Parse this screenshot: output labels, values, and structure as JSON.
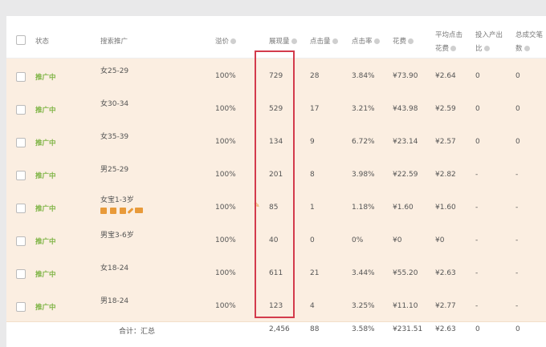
{
  "headers": {
    "status": "状态",
    "keyword": "搜索推广",
    "premium": "溢价",
    "impressions": "展现量",
    "clicks": "点击量",
    "ctr": "点击率",
    "cost": "花费",
    "avg_cpc_line1": "平均点击",
    "avg_cpc_line2": "花费",
    "roi_line1": "投入产出",
    "roi_line2": "比",
    "total_deals_line1": "总成交笔",
    "total_deals_line2": "数"
  },
  "rows": [
    {
      "status": "推广中",
      "name": "女25-29",
      "premium": "100%",
      "impressions": "729",
      "clicks": "28",
      "ctr": "3.84%",
      "cost": "¥73.90",
      "cpc": "¥2.64",
      "roi": "0",
      "deals": "0"
    },
    {
      "status": "推广中",
      "name": "女30-34",
      "premium": "100%",
      "impressions": "529",
      "clicks": "17",
      "ctr": "3.21%",
      "cost": "¥43.98",
      "cpc": "¥2.59",
      "roi": "0",
      "deals": "0"
    },
    {
      "status": "推广中",
      "name": "女35-39",
      "premium": "100%",
      "impressions": "134",
      "clicks": "9",
      "ctr": "6.72%",
      "cost": "¥23.14",
      "cpc": "¥2.57",
      "roi": "0",
      "deals": "0"
    },
    {
      "status": "推广中",
      "name": "男25-29",
      "premium": "100%",
      "impressions": "201",
      "clicks": "8",
      "ctr": "3.98%",
      "cost": "¥22.59",
      "cpc": "¥2.82",
      "roi": "-",
      "deals": "-"
    },
    {
      "status": "推广中",
      "name": "女宝1-3岁",
      "premium": "100%",
      "impressions": "85",
      "clicks": "1",
      "ctr": "1.18%",
      "cost": "¥1.60",
      "cpc": "¥1.60",
      "roi": "-",
      "deals": "-"
    },
    {
      "status": "推广中",
      "name": "男宝3-6岁",
      "premium": "100%",
      "impressions": "40",
      "clicks": "0",
      "ctr": "0%",
      "cost": "¥0",
      "cpc": "¥0",
      "roi": "-",
      "deals": "-"
    },
    {
      "status": "推广中",
      "name": "女18-24",
      "premium": "100%",
      "impressions": "611",
      "clicks": "21",
      "ctr": "3.44%",
      "cost": "¥55.20",
      "cpc": "¥2.63",
      "roi": "-",
      "deals": "-"
    },
    {
      "status": "推广中",
      "name": "男18-24",
      "premium": "100%",
      "impressions": "123",
      "clicks": "4",
      "ctr": "3.25%",
      "cost": "¥11.10",
      "cpc": "¥2.77",
      "roi": "-",
      "deals": "-"
    }
  ],
  "summary": {
    "label": "合计：汇总",
    "impressions": "2,456",
    "clicks": "88",
    "ctr": "3.58%",
    "cost": "¥231.51",
    "cpc": "¥2.63",
    "roi": "0",
    "deals": "0"
  },
  "icons": [
    "pause-icon",
    "report-icon",
    "delete-icon",
    "edit-icon",
    "trend-icon"
  ],
  "colors": {
    "status": "#7cb342",
    "highlight": "#d33b4c",
    "row_bg": "#fbeee1",
    "action": "#e89a3a"
  }
}
